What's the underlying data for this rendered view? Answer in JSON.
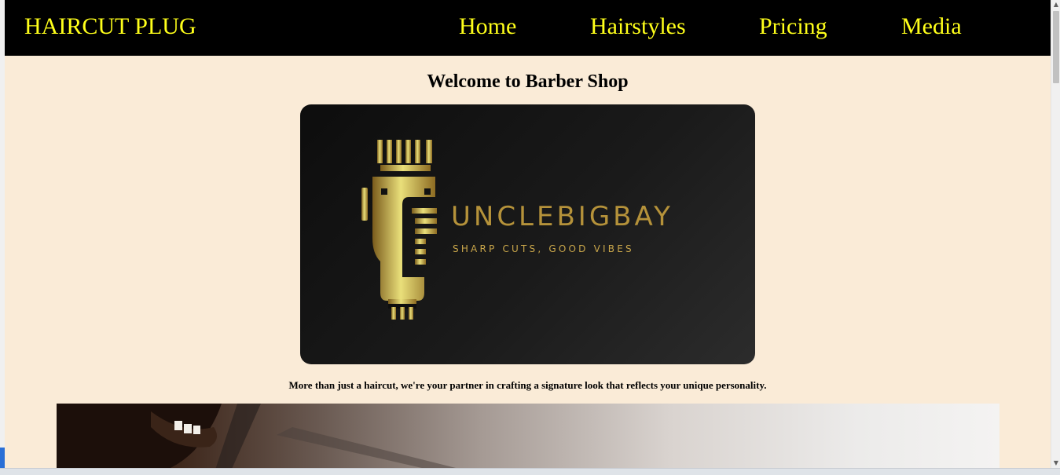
{
  "navbar": {
    "brand": "HAIRCUT PLUG",
    "links": [
      "Home",
      "Hairstyles",
      "Pricing",
      "Media"
    ]
  },
  "main": {
    "heading": "Welcome to Barber Shop",
    "logo": {
      "name": "UNCLEBIGBAY",
      "tagline": "SHARP CUTS, GOOD VIBES"
    },
    "description": "More than just a haircut, we're your partner in crafting a signature look that reflects your unique personality."
  },
  "colors": {
    "nav_background": "#000000",
    "nav_text": "#ffff1a",
    "page_background": "#faebd7",
    "logo_gold": "#c9a64a"
  }
}
